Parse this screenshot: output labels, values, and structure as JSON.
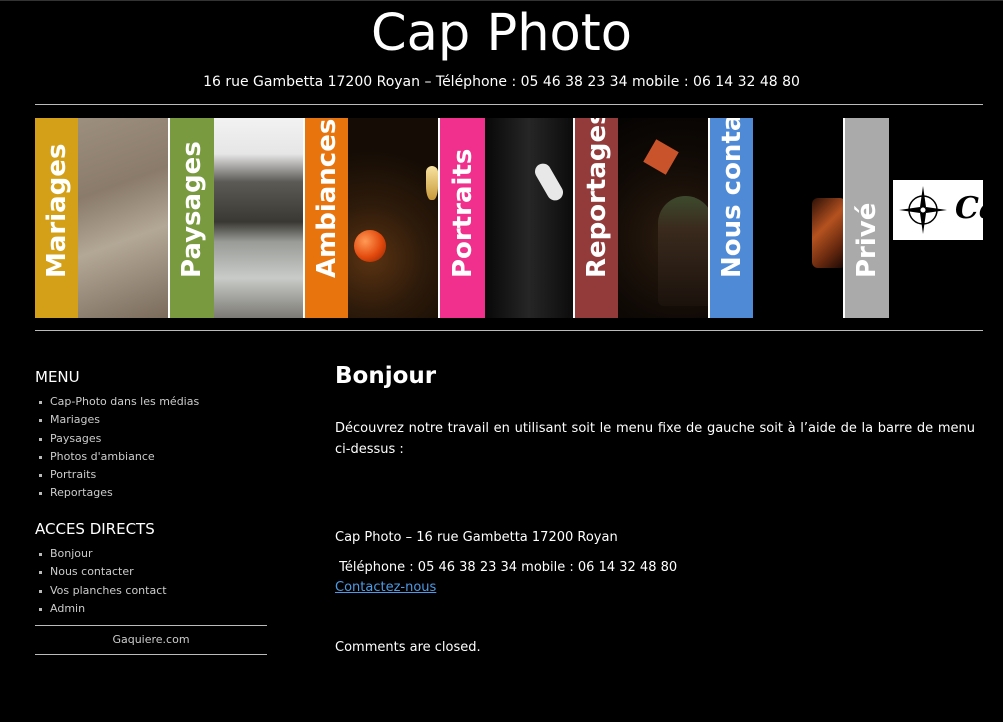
{
  "site": {
    "title": "Cap Photo",
    "address_line": "16 rue Gambetta 17200 Royan – Téléphone : 05 46 38 23 34 mobile : 06 14 32 48 80"
  },
  "banner": {
    "tabs": [
      {
        "label": "Mariages",
        "color": "#d4a017"
      },
      {
        "label": "Paysages",
        "color": "#7a9a3f"
      },
      {
        "label": "Ambiances",
        "color": "#e8740e"
      },
      {
        "label": "Portraits",
        "color": "#f0308c"
      },
      {
        "label": "Reportages",
        "color": "#933b3b"
      },
      {
        "label": "Nous contacter",
        "color": "#4f8ad6"
      },
      {
        "label": "Privé",
        "color": "#aaaaaa"
      }
    ],
    "logo_fragment": "Ca"
  },
  "sidebar": {
    "menu_heading": "MENU",
    "menu_items": [
      "Cap-Photo dans les médias",
      "Mariages",
      "Paysages",
      "Photos d'ambiance",
      "Portraits",
      "Reportages"
    ],
    "direct_heading": "ACCES DIRECTS",
    "direct_items": [
      "Bonjour",
      "Nous contacter",
      "Vos planches contact",
      "Admin"
    ],
    "footer": "Gaquiere.com"
  },
  "content": {
    "title": "Bonjour",
    "intro": "Découvrez notre travail en utilisant soit le menu fixe de gauche soit à l’aide de la barre de menu ci-dessus :",
    "address": "Cap Photo – 16 rue Gambetta 17200 Royan",
    "phone": " Téléphone : 05 46 38 23 34 mobile : 06 14 32 48 80",
    "contact_link": "Contactez-nous",
    "comments": "Comments are closed."
  }
}
